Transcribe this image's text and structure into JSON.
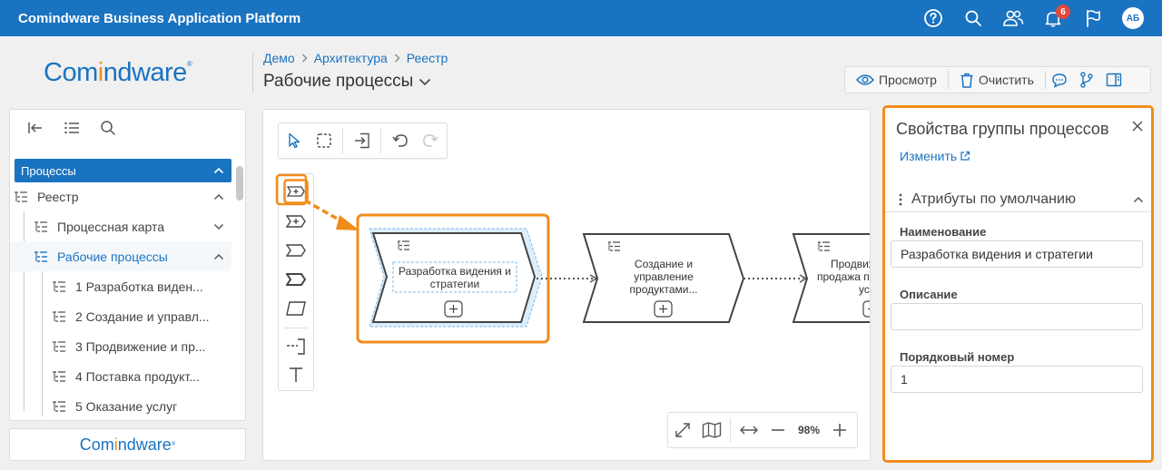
{
  "topbar": {
    "app_title": "Comindware Business Application Platform",
    "notifications_count": "6",
    "avatar_initials": "АБ",
    "color": "#1a73c0"
  },
  "logo": {
    "part1": "Com",
    "part2": "i",
    "part3": "ndware",
    "mark": "®"
  },
  "breadcrumb": [
    "Демо",
    "Архитектура",
    "Реестр"
  ],
  "page_title": "Рабочие процессы",
  "toolbar": {
    "preview_label": "Просмотр",
    "clear_label": "Очистить"
  },
  "sidebar": {
    "section_label": "Процессы",
    "items": [
      {
        "label": "Реестр",
        "level": 0
      },
      {
        "label": "Процессная карта",
        "level": 1
      },
      {
        "label": "Рабочие процессы",
        "level": 1,
        "active": true
      },
      {
        "label": "1 Разработка виден...",
        "level": 2
      },
      {
        "label": "2 Создание и управл...",
        "level": 2
      },
      {
        "label": "3 Продвижение и пр...",
        "level": 2
      },
      {
        "label": "4 Поставка продукт...",
        "level": 2
      },
      {
        "label": "5 Оказание услуг",
        "level": 2
      }
    ],
    "footer_logo": {
      "part1": "Com",
      "part2": "i",
      "part3": "ndware",
      "mark": "®"
    }
  },
  "diagram": {
    "shapes": [
      {
        "label_line1": "Разработка видения и",
        "label_line2": "стратегии",
        "selected": true
      },
      {
        "label_line1": "Создание и",
        "label_line2": "управление",
        "label_line3": "продуктами..."
      },
      {
        "label_line1": "Продвиж",
        "label_line2": "продажа пр",
        "label_line3": "усл"
      }
    ]
  },
  "zoom": {
    "value": "98%"
  },
  "properties": {
    "title": "Свойства группы процессов",
    "edit_link": "Изменить",
    "group_label": "Атрибуты по умолчанию",
    "fields": [
      {
        "label": "Наименование",
        "value": "Разработка видения и стратегии"
      },
      {
        "label": "Описание",
        "value": ""
      },
      {
        "label": "Порядковый номер",
        "value": "1"
      }
    ]
  },
  "colors": {
    "accent": "#1a73c0",
    "highlight": "#f28c1b",
    "badge": "#e2483d"
  }
}
